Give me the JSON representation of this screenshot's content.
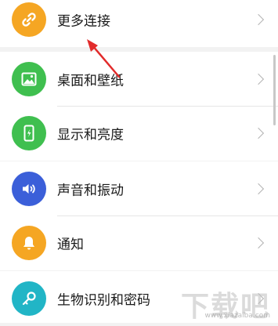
{
  "settings": {
    "items": [
      {
        "label": "更多连接",
        "icon": "link-icon",
        "color": "#f5a623"
      },
      {
        "label": "桌面和壁纸",
        "icon": "image-icon",
        "color": "#3fbf4f"
      },
      {
        "label": "显示和亮度",
        "icon": "phone-brightness-icon",
        "color": "#3fbf4f"
      },
      {
        "label": "声音和振动",
        "icon": "speaker-icon",
        "color": "#3b5fd9"
      },
      {
        "label": "通知",
        "icon": "bell-icon",
        "color": "#f5a623"
      },
      {
        "label": "生物识别和密码",
        "icon": "key-icon",
        "color": "#21b5c6"
      }
    ]
  },
  "watermark": {
    "text": "下载吧",
    "url": "www.xiazaiba.com"
  }
}
